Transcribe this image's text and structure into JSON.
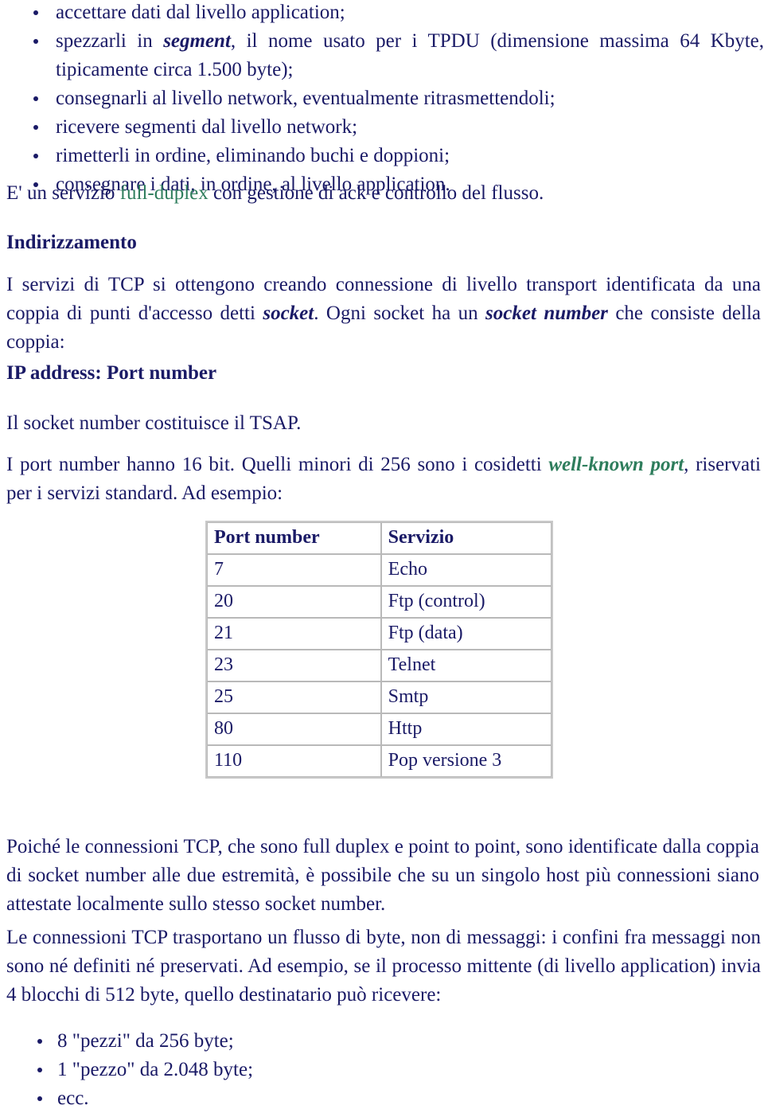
{
  "colors": {
    "text": "#1a1a66",
    "accent_green": "#2e7d5c",
    "table_border": "#c9c9c9",
    "page_background": "#ffffff"
  },
  "top_list": {
    "items": [
      {
        "pre": "accettare dati dal livello application;",
        "em": "",
        "post": ""
      },
      {
        "pre": "spezzarli in ",
        "em": "segment",
        "post": ", il nome usato per i TPDU (dimensione massima 64 Kbyte, tipicamente circa 1.500 byte);"
      },
      {
        "pre": "consegnarli al livello network, eventualmente ritrasmettendoli;",
        "em": "",
        "post": ""
      },
      {
        "pre": "ricevere segmenti dal livello network;",
        "em": "",
        "post": ""
      },
      {
        "pre": "rimetterli in ordine, eliminando buchi e doppioni;",
        "em": "",
        "post": ""
      },
      {
        "pre": "consegnare i dati, in ordine, al livello application.",
        "em": "",
        "post": ""
      }
    ]
  },
  "full_duplex_para": {
    "pre": "E' un servizio ",
    "green": "full-duplex",
    "post": " con gestione di ack e controllo del flusso."
  },
  "heading_indirizzamento": "Indirizzamento",
  "servizi_para": {
    "part1": "I servizi di TCP si ottengono creando connessione di livello transport identificata da una coppia di punti d'accesso detti ",
    "em1": "socket",
    "part2": ". Ogni socket ha un ",
    "em2": "socket number",
    "part3": " che consiste della coppia:"
  },
  "heading_ip_address": "IP address: Port number",
  "tsap_para": "Il socket number costituisce il TSAP.",
  "port_bits_para": {
    "part1": "I port number hanno 16 bit. Quelli minori di 256 sono i cosidetti ",
    "green_em": "well-known port",
    "part2": ", riservati per i servizi standard. Ad esempio:"
  },
  "port_table": {
    "columns": [
      "Port number",
      "Servizio"
    ],
    "rows": [
      [
        "7",
        "Echo"
      ],
      [
        "20",
        "Ftp (control)"
      ],
      [
        "21",
        "Ftp (data)"
      ],
      [
        "23",
        "Telnet"
      ],
      [
        "25",
        "Smtp"
      ],
      [
        "80",
        "Http"
      ],
      [
        "110",
        "Pop versione 3"
      ]
    ]
  },
  "poiche_para": "Poiché le connessioni TCP, che sono full duplex e point to point, sono identificate dalla coppia di socket number alle due estremità, è possibile che su un singolo host più connessioni siano attestate localmente sullo stesso socket number.",
  "flusso_para": "Le connessioni TCP trasportano un flusso di byte, non di messaggi: i confini fra messaggi non sono né definiti né preservati. Ad esempio, se il processo mittente (di livello application) invia 4 blocchi di 512 byte, quello destinatario può ricevere:",
  "bottom_list": {
    "items": [
      "8 \"pezzi\" da 256 byte;",
      "1 \"pezzo\" da 2.048 byte;",
      "ecc."
    ]
  }
}
